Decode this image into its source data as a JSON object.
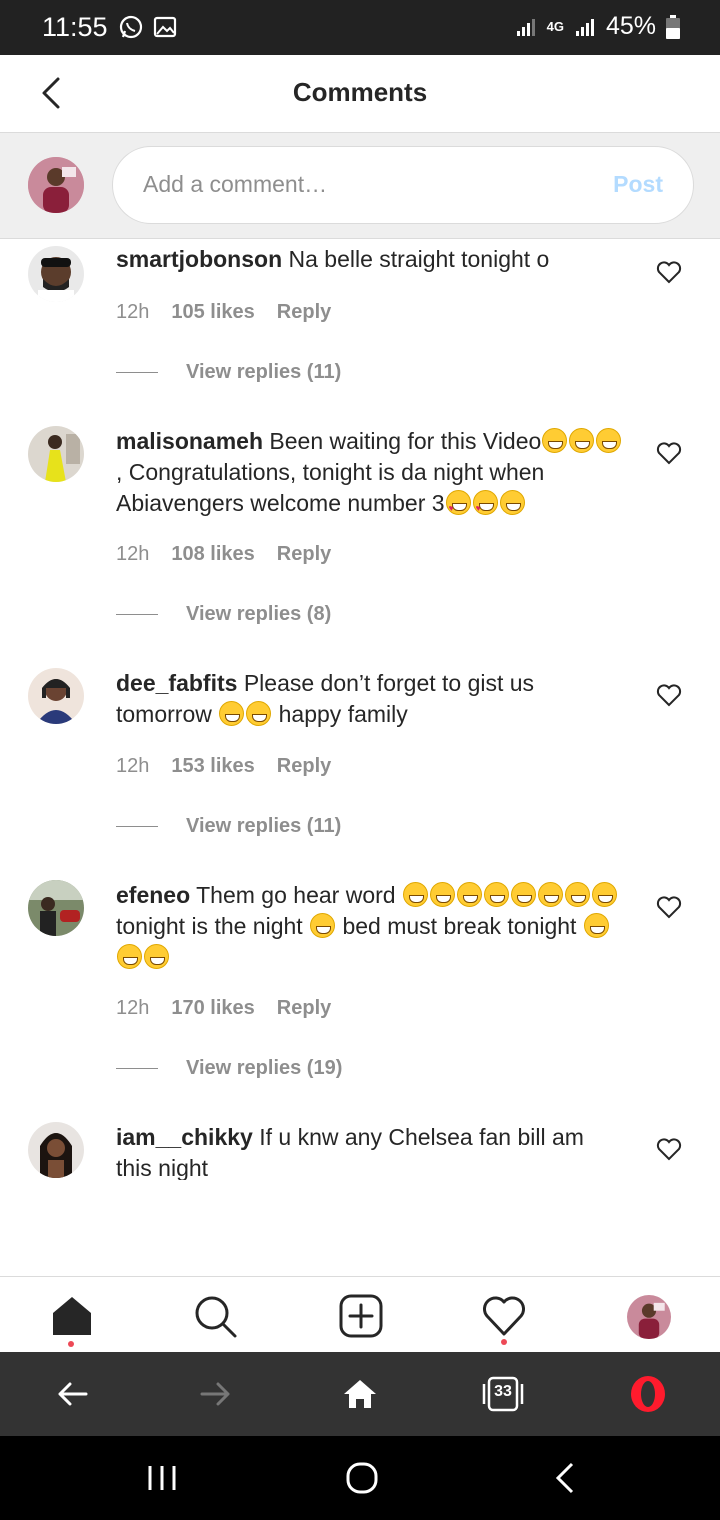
{
  "status_bar": {
    "time": "11:55",
    "network": "4G",
    "battery": "45%"
  },
  "header": {
    "title": "Comments"
  },
  "composer": {
    "placeholder": "Add a comment…",
    "post_label": "Post"
  },
  "comments": [
    {
      "username": "smartjobonson",
      "text": "Na belle straight tonight o",
      "time": "12h",
      "likes": "105 likes",
      "reply_label": "Reply",
      "view_replies": "View replies (11)"
    },
    {
      "username": "malisonameh",
      "text_parts": [
        "Been waiting for this Video",
        ", Congratulations, tonight is da night when Abiavengers welcome number 3"
      ],
      "time": "12h",
      "likes": "108 likes",
      "reply_label": "Reply",
      "view_replies": "View replies (8)"
    },
    {
      "username": "dee_fabfits",
      "text_parts": [
        "Please don’t forget to gist us tomorrow ",
        " happy family"
      ],
      "time": "12h",
      "likes": "153 likes",
      "reply_label": "Reply",
      "view_replies": "View replies (11)"
    },
    {
      "username": "efeneo",
      "text_parts": [
        "Them go hear word ",
        " tonight is the night ",
        " bed must break tonight "
      ],
      "time": "12h",
      "likes": "170 likes",
      "reply_label": "Reply",
      "view_replies": "View replies (19)"
    },
    {
      "username": "iam__chikky",
      "text": "If u knw any Chelsea fan bill am this night"
    }
  ],
  "bottom_nav": [
    "home-icon",
    "search-icon",
    "new-post-icon",
    "activity-icon",
    "profile-avatar"
  ],
  "browser_bar": {
    "tabs_count": "33"
  },
  "colors": {
    "accent_disabled": "#b3dbff",
    "notification_dot": "#ed4956",
    "opera_red": "#ff1b2d"
  }
}
